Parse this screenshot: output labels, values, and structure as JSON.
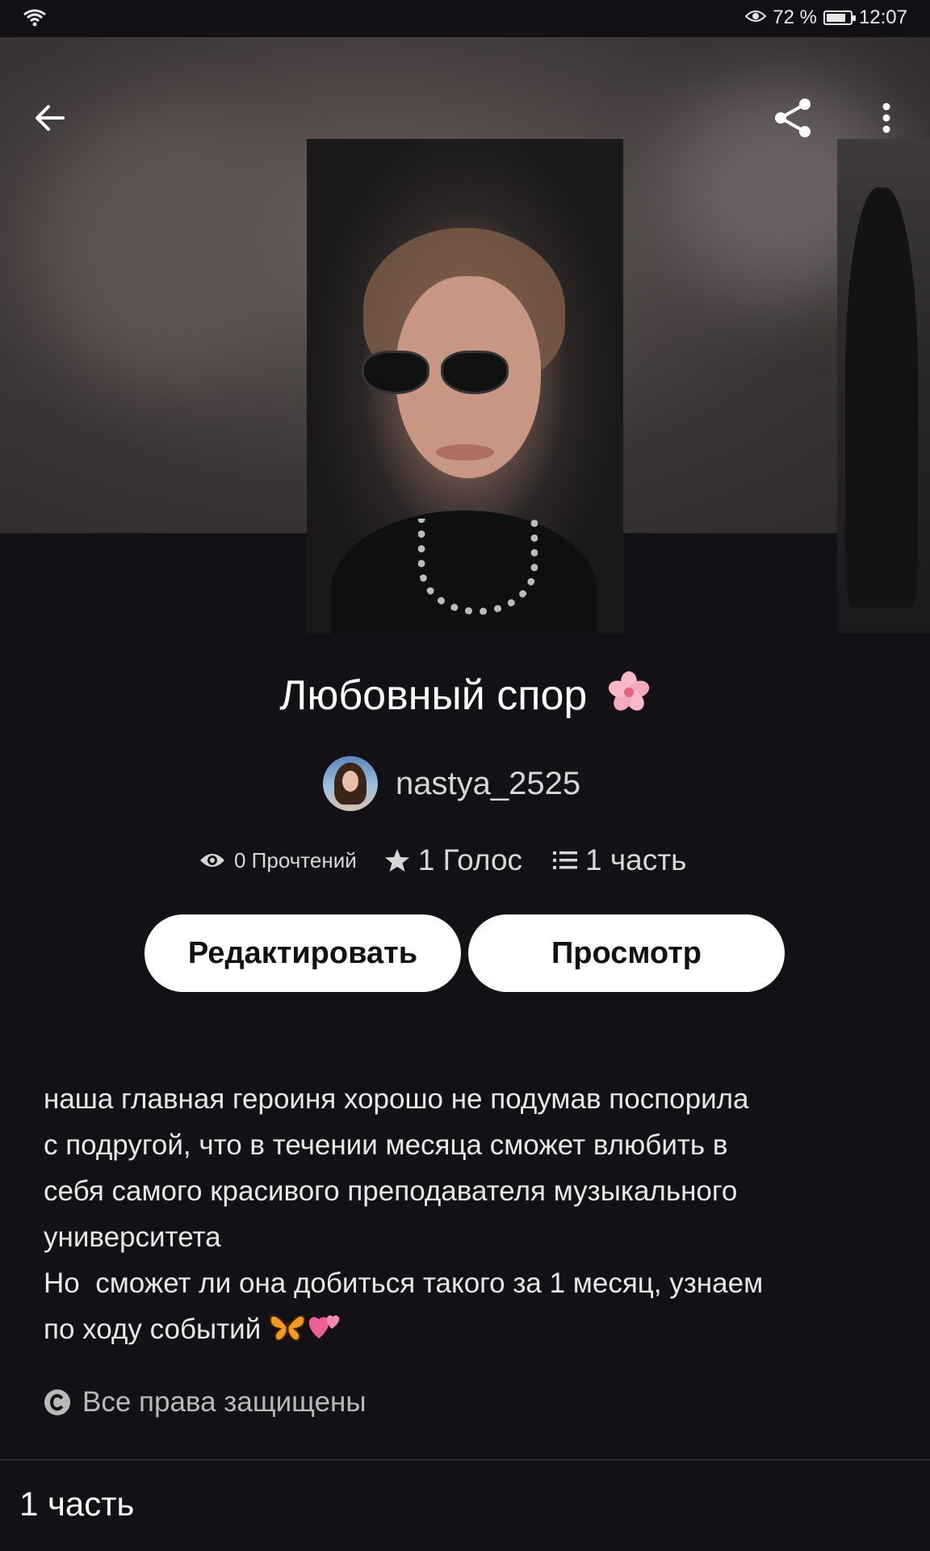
{
  "status_bar": {
    "eye_percent": "72 %",
    "time": "12:07",
    "battery_level": 0.72
  },
  "top_bar": {
    "back_icon": "arrow-left-icon",
    "share_icon": "share-icon",
    "more_icon": "more-vertical-icon"
  },
  "story": {
    "title": "Любовный спор",
    "title_emoji": "cherry-blossom",
    "author": "nastya_2525",
    "stats": {
      "reads": "0 Прочтений",
      "votes": "1 Голос",
      "parts": "1 часть"
    },
    "buttons": {
      "edit": "Редактировать",
      "preview": "Просмотр"
    },
    "description_main": "наша главная героиня хорошо не подумав поспорила\nс подругой, что в течении месяца сможет влюбить в\nсебя самого красивого преподавателя музыкального\nуниверситета\nНо  сможет ли она добиться такого за 1 месяц, узнаем\nпо ходу событий ",
    "description_emojis": [
      "butterfly",
      "two-hearts"
    ],
    "copyright": "Все права защищены"
  },
  "parts_section": {
    "label": "1 часть"
  },
  "colors": {
    "background": "#131116",
    "button_bg": "#ffffff",
    "text_muted": "#d7d7d7"
  }
}
